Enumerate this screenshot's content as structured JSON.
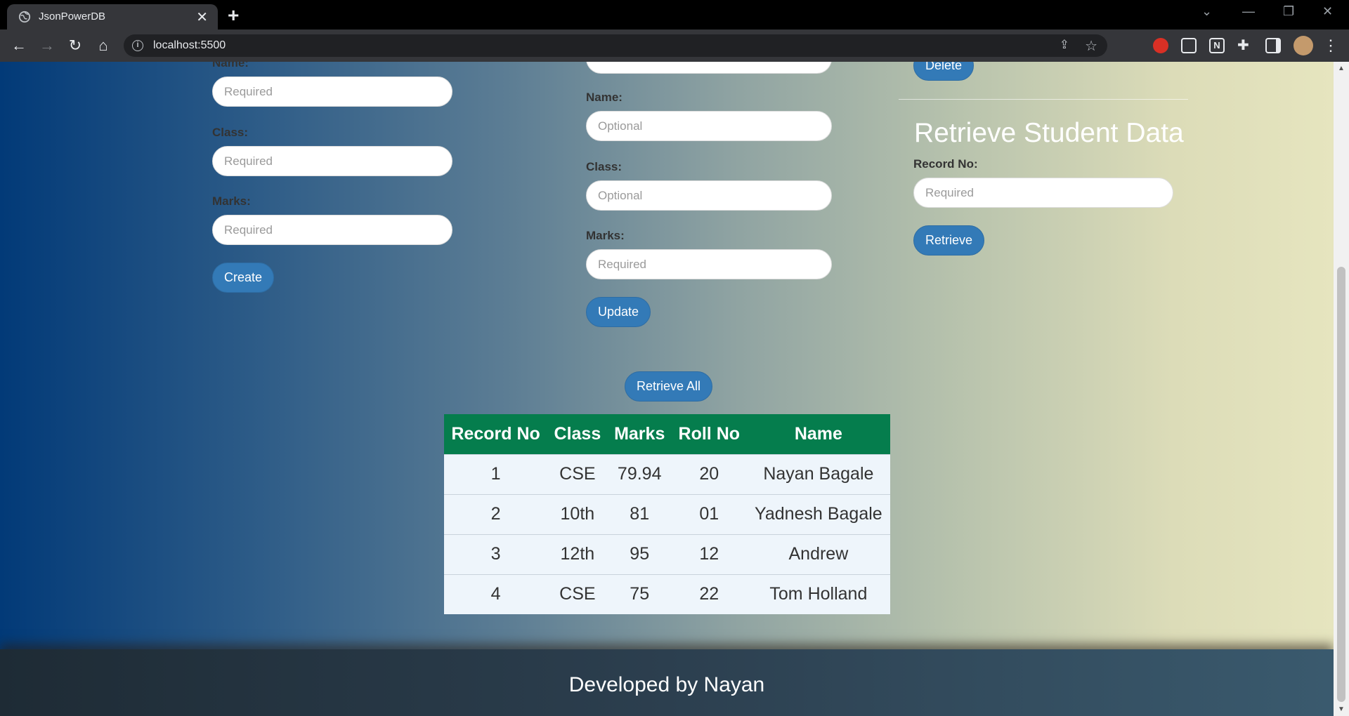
{
  "browser": {
    "tab_title": "JsonPowerDB",
    "tab_close": "✕",
    "new_tab": "+",
    "url": "localhost:5500"
  },
  "create_form": {
    "name_label": "Name:",
    "name_placeholder": "Required",
    "class_label": "Class:",
    "class_placeholder": "Required",
    "marks_label": "Marks:",
    "marks_placeholder": "Required",
    "button": "Create"
  },
  "update_form": {
    "name_label": "Name:",
    "name_placeholder": "Optional",
    "class_label": "Class:",
    "class_placeholder": "Optional",
    "marks_label": "Marks:",
    "marks_placeholder": "Required",
    "button": "Update"
  },
  "delete_button": "Delete",
  "retrieve_section": {
    "title": "Retrieve Student Data",
    "record_label": "Record No:",
    "record_placeholder": "Required",
    "button": "Retrieve"
  },
  "retrieve_all_button": "Retrieve All",
  "table": {
    "headers": [
      "Record No",
      "Class",
      "Marks",
      "Roll No",
      "Name"
    ],
    "rows": [
      [
        "1",
        "CSE",
        "79.94",
        "20",
        "Nayan Bagale"
      ],
      [
        "2",
        "10th",
        "81",
        "01",
        "Yadnesh Bagale"
      ],
      [
        "3",
        "12th",
        "95",
        "12",
        "Andrew"
      ],
      [
        "4",
        "CSE",
        "75",
        "22",
        "Tom Holland"
      ]
    ]
  },
  "footer": "Developed by Nayan"
}
